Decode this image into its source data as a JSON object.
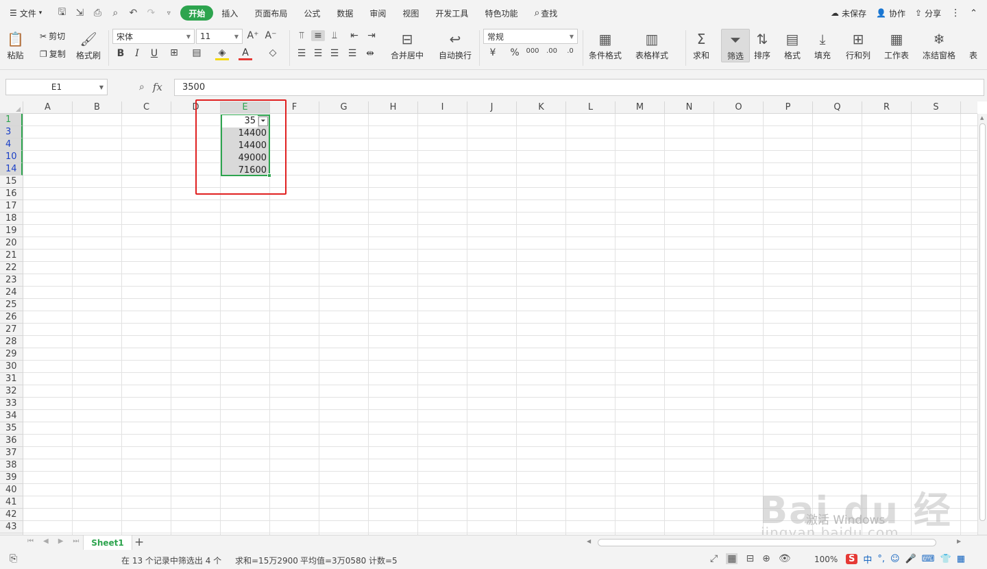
{
  "menubar": {
    "file": "文件",
    "tabs": [
      "开始",
      "插入",
      "页面布局",
      "公式",
      "数据",
      "审阅",
      "视图",
      "开发工具",
      "特色功能"
    ],
    "search": "查找",
    "unsaved": "未保存",
    "collab": "协作",
    "share": "分享"
  },
  "ribbon": {
    "paste": "粘贴",
    "cut": "剪切",
    "copy": "复制",
    "format_painter": "格式刷",
    "font_name": "宋体",
    "font_size": "11",
    "merge_center": "合并居中",
    "wrap_text": "自动换行",
    "number_format": "常规",
    "cond_format": "条件格式",
    "table_style": "表格样式",
    "sum": "求和",
    "filter": "筛选",
    "sort": "排序",
    "format": "格式",
    "fill": "填充",
    "rows_cols": "行和列",
    "worksheet": "工作表",
    "freeze": "冻结窗格",
    "table_tools": "表"
  },
  "formula_bar": {
    "name_box": "E1",
    "formula": "3500",
    "fx": "fx"
  },
  "columns": [
    "A",
    "B",
    "C",
    "D",
    "E",
    "F",
    "G",
    "H",
    "I",
    "J",
    "K",
    "L",
    "M",
    "N",
    "O",
    "P",
    "Q",
    "R",
    "S"
  ],
  "rows": [
    "1",
    "3",
    "4",
    "10",
    "14",
    "15",
    "16",
    "17",
    "18",
    "19",
    "20",
    "21",
    "22",
    "23",
    "24",
    "25",
    "26",
    "27",
    "28",
    "29",
    "30",
    "31",
    "32",
    "33",
    "34",
    "35",
    "36",
    "37",
    "38",
    "39",
    "40",
    "41",
    "42",
    "43"
  ],
  "cells": {
    "e1": "35",
    "e3": "14400",
    "e4": "14400",
    "e10": "49000",
    "e14": "71600"
  },
  "sheets": {
    "active": "Sheet1"
  },
  "status": {
    "filter_info": "在 13 个记录中筛选出 4 个",
    "sum": "求和=15万2900",
    "avg": "平均值=3万0580",
    "count": "计数=5",
    "zoom": "100%"
  },
  "ime": {
    "lang": "中"
  },
  "watermark": {
    "activate": "激活 Windows",
    "brand": "Bai du 经验",
    "url": "jingyan.baidu.com"
  },
  "colors": {
    "accent": "#2da44e",
    "annotation": "#e02020",
    "filtered_row": "#1a3fc6"
  }
}
